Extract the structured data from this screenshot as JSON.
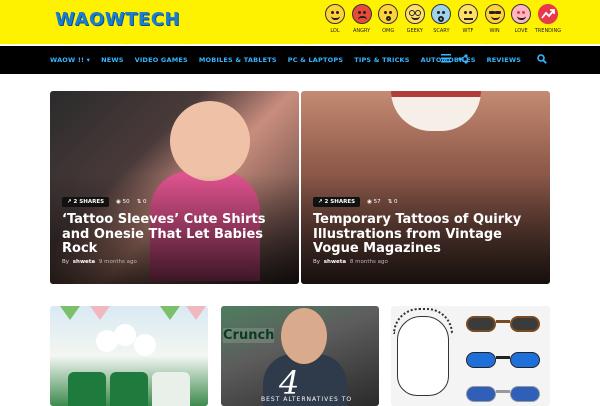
{
  "site": {
    "logo": "WAOWTECH"
  },
  "reactions": [
    {
      "label": "LOL",
      "icon": "lol-face-icon",
      "color": "#ffd23a"
    },
    {
      "label": "ANGRY",
      "icon": "angry-face-icon",
      "color": "#e84a3a"
    },
    {
      "label": "OMG",
      "icon": "omg-face-icon",
      "color": "#ffd23a"
    },
    {
      "label": "GEEKY",
      "icon": "geeky-face-icon",
      "color": "#ffe066"
    },
    {
      "label": "SCARY",
      "icon": "scary-face-icon",
      "color": "#9fd3ec"
    },
    {
      "label": "WTF",
      "icon": "wtf-face-icon",
      "color": "#ffe066"
    },
    {
      "label": "WIN",
      "icon": "win-face-icon",
      "color": "#ffd23a"
    },
    {
      "label": "LOVE",
      "icon": "love-face-icon",
      "color": "#ffb6c1"
    },
    {
      "label": "TRENDING",
      "icon": "trending-icon",
      "color": "#e8394a"
    }
  ],
  "nav": {
    "items": [
      "WAOW !! ▾",
      "NEWS",
      "VIDEO GAMES",
      "MOBILES & TABLETS",
      "PC & LAPTOPS",
      "TIPS & TRICKS",
      "AUTOMOBILES",
      "REVIEWS"
    ],
    "menu_icon": "hamburger-icon",
    "share_icon": "share-icon",
    "search_icon": "search-icon"
  },
  "featured": [
    {
      "shares": "2 SHARES",
      "views": "50",
      "comments": "0",
      "title": "‘Tattoo Sleeves’ Cute Shirts and Onesie That Let Babies Rock",
      "by": "By",
      "author": "shweta",
      "time": "9 months ago"
    },
    {
      "shares": "2 SHARES",
      "views": "57",
      "comments": "0",
      "title": "Temporary Tattoos of Quirky Illustrations from Vintage Vogue Magazines",
      "by": "By",
      "author": "shweta",
      "time": "8 months ago"
    }
  ],
  "tiles": [
    {
      "icon": "mason-jars-image"
    },
    {
      "big_number": "4",
      "subtitle": "BEST ALTERNATIVES TO",
      "watermark": "Crunch"
    },
    {
      "icon": "sunglasses-image"
    }
  ],
  "colors": {
    "accent": "#36b6ff",
    "header_bg": "#fff200",
    "nav_bg": "#000000"
  }
}
